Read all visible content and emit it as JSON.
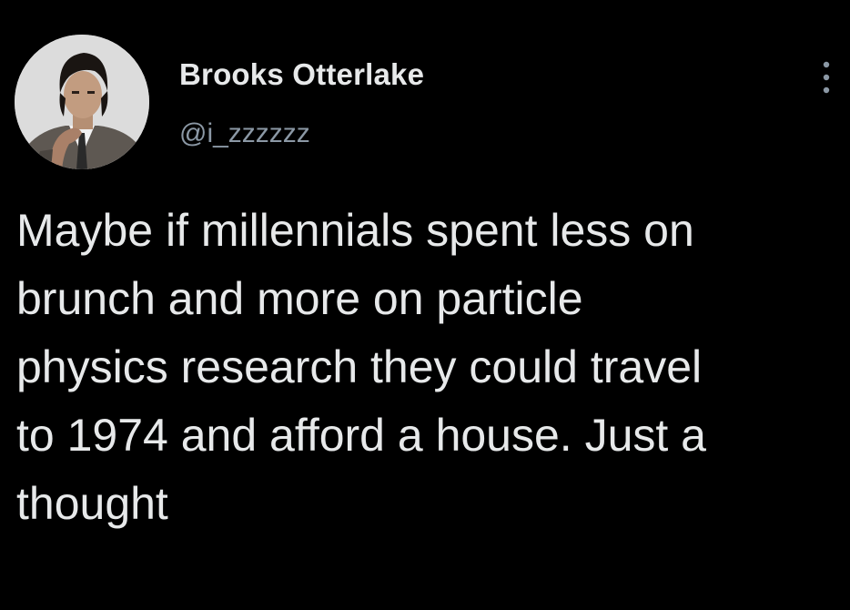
{
  "tweet": {
    "author": {
      "display_name": "Brooks Otterlake",
      "handle": "@i_zzzzzz",
      "avatar_icon": "profile-photo"
    },
    "more_icon": "more-vertical-icon",
    "text": "Maybe if millennials spent less on\nbrunch and more on particle\nphysics research they could travel\nto 1974 and afford a house. Just a\nthought"
  },
  "colors": {
    "background": "#000000",
    "primary_text": "#e7e9ea",
    "secondary_text": "#8b98a5"
  }
}
